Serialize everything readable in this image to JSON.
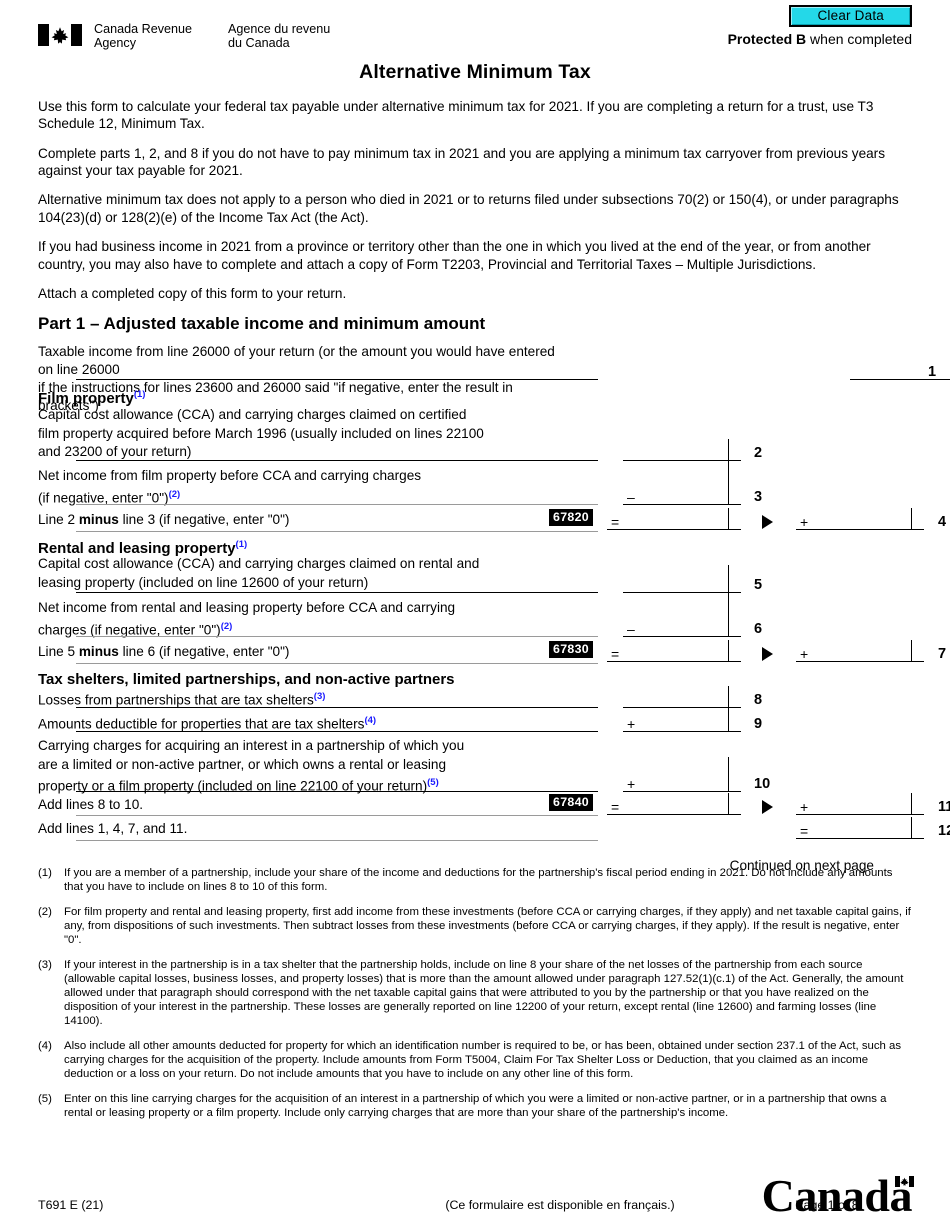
{
  "header": {
    "clear_data_label": "Clear Data",
    "agency_en": "Canada Revenue\nAgency",
    "agency_fr": "Agence du revenu\ndu Canada",
    "protected_bold": "Protected B",
    "protected_rest": " when completed",
    "logo_icon": "canada-flag-icon"
  },
  "title": "Alternative Minimum Tax",
  "intro": [
    "Use this form to calculate your federal tax payable under alternative minimum tax for 2021. If you are completing a return for a trust, use T3 Schedule 12, Minimum Tax.",
    "Complete parts 1, 2, and 8 if you do not have to pay minimum tax in 2021 and you are applying a minimum tax carryover from previous years against your tax payable for 2021.",
    "Alternative minimum tax does not apply to a person who died in 2021 or to returns filed under subsections 70(2) or 150(4), or under paragraphs 104(23)(d) or 128(2)(e) of the Income Tax Act (the Act).",
    "If you had business income in 2021 from a province or territory other than the one in which you lived at the end of the year, or from another country, you may also have to complete and attach a copy of Form T2203, Provincial and Territorial Taxes – Multiple Jurisdictions.",
    "Attach a completed copy of this form to your return."
  ],
  "part1": {
    "heading": "Part 1 – Adjusted taxable income and minimum amount",
    "line1": {
      "desc_l1": "Taxable income from line 26000 of your return (or the amount you would have entered on line 26000",
      "desc_l2": "if the instructions for lines 23600 and 26000 said \"if negative, enter the result in brackets\")",
      "number": "1",
      "value": ""
    },
    "film": {
      "heading": "Film property",
      "heading_fn": "(1)",
      "line2": {
        "desc_l1": "Capital cost allowance (CCA) and carrying charges claimed on certified",
        "desc_l2": "film property acquired before March 1996 (usually included on lines 22100",
        "desc_l3": "and 23200 of your return)",
        "number": "2",
        "value": ""
      },
      "line3": {
        "desc_l1": "Net income from film property before CCA and carrying charges",
        "desc_l2": "(if negative, enter \"0\")",
        "desc_fn": "(2)",
        "operator": "–",
        "number": "3",
        "value": ""
      },
      "line4": {
        "desc_pre": "Line 2 ",
        "desc_bold": "minus",
        "desc_post": " line 3 (if negative, enter \"0\")",
        "field_code": "67820",
        "operator_mid": "=",
        "operator_right": "+",
        "number": "4",
        "value_mid": "",
        "value_right": ""
      }
    },
    "rental": {
      "heading": "Rental and leasing property",
      "heading_fn": "(1)",
      "line5": {
        "desc_l1": "Capital cost allowance (CCA) and carrying charges claimed on rental and",
        "desc_l2": "leasing property (included on line 12600 of your return)",
        "number": "5",
        "value": ""
      },
      "line6": {
        "desc_l1": "Net income from rental and leasing property before CCA and carrying",
        "desc_l2": "charges (if negative, enter \"0\")",
        "desc_fn": "(2)",
        "operator": "–",
        "number": "6",
        "value": ""
      },
      "line7": {
        "desc_pre": "Line 5 ",
        "desc_bold": "minus",
        "desc_post": " line 6 (if negative, enter \"0\")",
        "field_code": "67830",
        "operator_mid": "=",
        "operator_right": "+",
        "number": "7",
        "value_mid": "",
        "value_right": ""
      }
    },
    "shelters": {
      "heading": "Tax shelters, limited partnerships, and non-active partners",
      "line8": {
        "desc": "Losses from partnerships that are tax shelters",
        "desc_fn": "(3)",
        "number": "8",
        "value": ""
      },
      "line9": {
        "desc": "Amounts deductible for properties that are tax shelters",
        "desc_fn": "(4)",
        "operator": "+",
        "number": "9",
        "value": ""
      },
      "line10": {
        "desc_l1": "Carrying charges for acquiring an interest in a partnership of which you",
        "desc_l2": "are a limited or non-active partner, or which owns a rental or leasing",
        "desc_l3": "property or a film property (included on line 22100 of your return)",
        "desc_fn": "(5)",
        "operator": "+",
        "number": "10",
        "value": ""
      },
      "line11": {
        "desc": "Add lines 8 to 10.",
        "field_code": "67840",
        "operator_mid": "=",
        "operator_right": "+",
        "number": "11",
        "value_mid": "",
        "value_right": ""
      },
      "line12": {
        "desc": "Add lines 1, 4, 7, and 11.",
        "operator_right": "=",
        "number": "12",
        "value_right": ""
      }
    },
    "continued": "Continued on next page"
  },
  "footnotes": [
    {
      "num": "(1)",
      "text": "If you are a member of a partnership, include your share of the income and deductions for the partnership's fiscal period ending in 2021. Do not include any amounts that you have to include on lines 8 to 10 of this form."
    },
    {
      "num": "(2)",
      "text": "For film property and rental and leasing property, first add income from these investments (before CCA or carrying charges, if they apply) and net taxable capital gains, if any, from dispositions of such investments. Then subtract losses from these investments (before CCA or carrying charges, if they apply). If the result is negative, enter \"0\"."
    },
    {
      "num": "(3)",
      "text": "If your interest in the partnership is in a tax shelter that the partnership holds, include on line 8 your share of the net losses of the partnership from each source (allowable capital losses, business losses, and property losses) that is more than the amount allowed under paragraph 127.52(1)(c.1) of the Act. Generally, the amount allowed under that paragraph should correspond with the net taxable capital gains that were attributed to you by the partnership or that you have realized on the disposition of your interest in the partnership. These losses are generally reported on line 12200 of your return, except rental (line 12600) and farming losses (line 14100)."
    },
    {
      "num": "(4)",
      "text": "Also include all other amounts deducted for property for which an identification number is required to be, or has been, obtained under section 237.1 of the Act, such as carrying charges for the acquisition of the property. Include amounts from Form T5004, Claim For Tax Shelter Loss or Deduction, that you claimed as an income deduction or a loss on your return. Do not include amounts that you have to include on any other line of this form."
    },
    {
      "num": "(5)",
      "text": "Enter on this line carrying charges for the acquisition of an interest in a partnership of which you were a limited or non-active partner, or in a partnership that owns a rental or leasing property or a film property. Include only carrying charges that are more than your share of the partnership's income."
    }
  ],
  "footer": {
    "form_code": "T691 E (21)",
    "french_note": "(Ce formulaire est disponible en français.)",
    "page": "Page 1 of 8",
    "wordmark": "Canada",
    "wordmark_flag_icon": "canada-flag-icon"
  },
  "colors": {
    "footnote_blue": "#1a1aff",
    "clear_data_cyan": "#24d8e8",
    "field_code_bg": "#000000"
  }
}
